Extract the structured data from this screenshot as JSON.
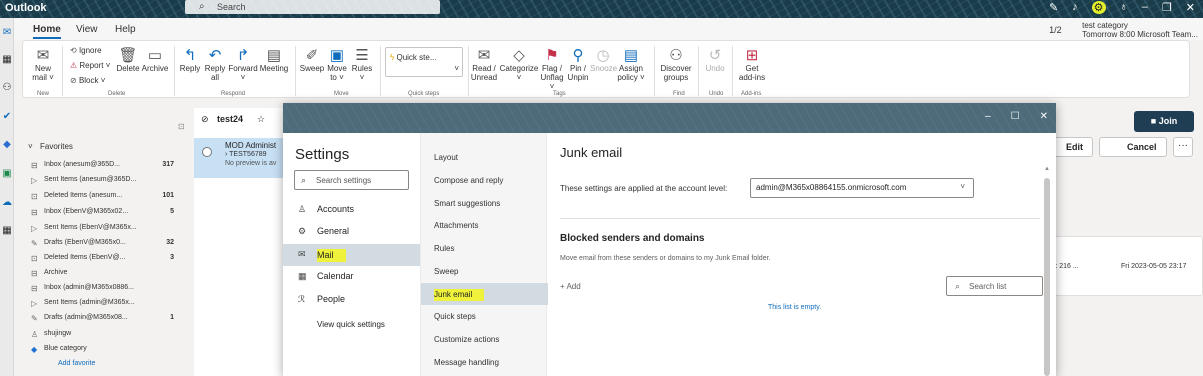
{
  "topbar": {
    "app_name": "Outlook",
    "search_placeholder": "Search"
  },
  "ribbon": {
    "tabs": [
      "Home",
      "View",
      "Help"
    ],
    "reminder": {
      "count": "1/2",
      "title": "test category",
      "subtitle": "Tomorrow 8:00 Microsoft Team..."
    },
    "new": {
      "label1": "New",
      "label2": "mail",
      "group": "New"
    },
    "delete_group": {
      "ignore": "Ignore",
      "report": "Report",
      "block": "Block",
      "delete": "Delete",
      "archive": "Archive",
      "group": "Delete"
    },
    "respond_group": {
      "reply": "Reply",
      "reply_all_1": "Reply",
      "reply_all_2": "all",
      "forward": "Forward",
      "meeting": "Meeting",
      "group": "Respond"
    },
    "move_group": {
      "sweep": "Sweep",
      "move_1": "Move",
      "move_2": "to",
      "rules": "Rules",
      "group": "Move"
    },
    "quick_steps": {
      "label": "Quick ste...",
      "group": "Quick steps"
    },
    "tags_group": {
      "read_1": "Read /",
      "read_2": "Unread",
      "categorize": "Categorize",
      "flag_1": "Flag /",
      "flag_2": "Unflag",
      "pin_1": "Pin /",
      "pin_2": "Unpin",
      "snooze": "Snooze",
      "policy_1": "Assign",
      "policy_2": "policy",
      "group": "Tags"
    },
    "find_group": {
      "label1": "Discover",
      "label2": "groups",
      "group": "Find"
    },
    "undo_group": {
      "label": "Undo",
      "group": "Undo"
    },
    "addins_group": {
      "label1": "Get",
      "label2": "add-ins",
      "group": "Add-ins"
    }
  },
  "folders": {
    "favorites_label": "Favorites",
    "items": [
      {
        "label": "Inbox (anesum@365D...",
        "count": "317",
        "icon": "inbox-icon"
      },
      {
        "label": "Sent Items (anesum@365D...",
        "count": "",
        "icon": "send-icon"
      },
      {
        "label": "Deleted Items (anesum...",
        "count": "101",
        "icon": "trash-icon"
      },
      {
        "label": "Inbox (EbenV@M365x02...",
        "count": "5",
        "icon": "inbox-icon"
      },
      {
        "label": "Sent Items (EbenV@M365x...",
        "count": "",
        "icon": "send-icon"
      },
      {
        "label": "Drafts (EbenV@M365x0...",
        "count": "32",
        "icon": "pencil-icon"
      },
      {
        "label": "Deleted Items (EbenV@...",
        "count": "3",
        "icon": "trash-icon"
      },
      {
        "label": "Archive",
        "count": "",
        "icon": "archive-icon"
      },
      {
        "label": "Inbox (admin@M365x0886...",
        "count": "",
        "icon": "inbox-icon"
      },
      {
        "label": "Sent Items (admin@M365x...",
        "count": "",
        "icon": "send-icon"
      },
      {
        "label": "Drafts (admin@M365x08...",
        "count": "1",
        "icon": "pencil-icon"
      },
      {
        "label": "shujingw",
        "count": "",
        "icon": "person-icon"
      },
      {
        "label": "Blue category",
        "count": "",
        "icon": "tag-icon"
      }
    ],
    "add_favorite": "Add favorite"
  },
  "message_list": {
    "header": "test24",
    "message": {
      "from": "MOD Administ",
      "subject": "TEST56789",
      "preview": "No preview is av"
    }
  },
  "reading": {
    "join": "Join",
    "edit": "Edit",
    "cancel": "Cancel",
    "more": "···",
    "card_left": "): 216 ...",
    "card_right": "Fri 2023-05-05 23:17"
  },
  "settings": {
    "title": "Settings",
    "search_placeholder": "Search settings",
    "categories": [
      {
        "label": "Accounts",
        "icon": "person-icon"
      },
      {
        "label": "General",
        "icon": "gear-icon"
      },
      {
        "label": "Mail",
        "icon": "mail-icon"
      },
      {
        "label": "Calendar",
        "icon": "calendar-icon"
      },
      {
        "label": "People",
        "icon": "people-icon"
      }
    ],
    "view_quick": "View quick settings",
    "mail_subs": [
      "Layout",
      "Compose and reply",
      "Smart suggestions",
      "Attachments",
      "Rules",
      "Sweep",
      "Junk email",
      "Quick steps",
      "Customize actions",
      "Message handling"
    ],
    "selected_sub": "Junk email",
    "content": {
      "title": "Junk email",
      "account_level": "These settings are applied at the account level:",
      "account": "admin@M365x08864155.onmicrosoft.com",
      "blocked_title": "Blocked senders and domains",
      "blocked_desc": "Move email from these senders or domains to my Junk Email folder.",
      "add": "Add",
      "search_list": "Search list",
      "empty": "This list is empty."
    }
  },
  "colors": {
    "accent": "#0f6cbd",
    "highlight": "#eef23a",
    "dialog_title": "#4d6b7a"
  }
}
